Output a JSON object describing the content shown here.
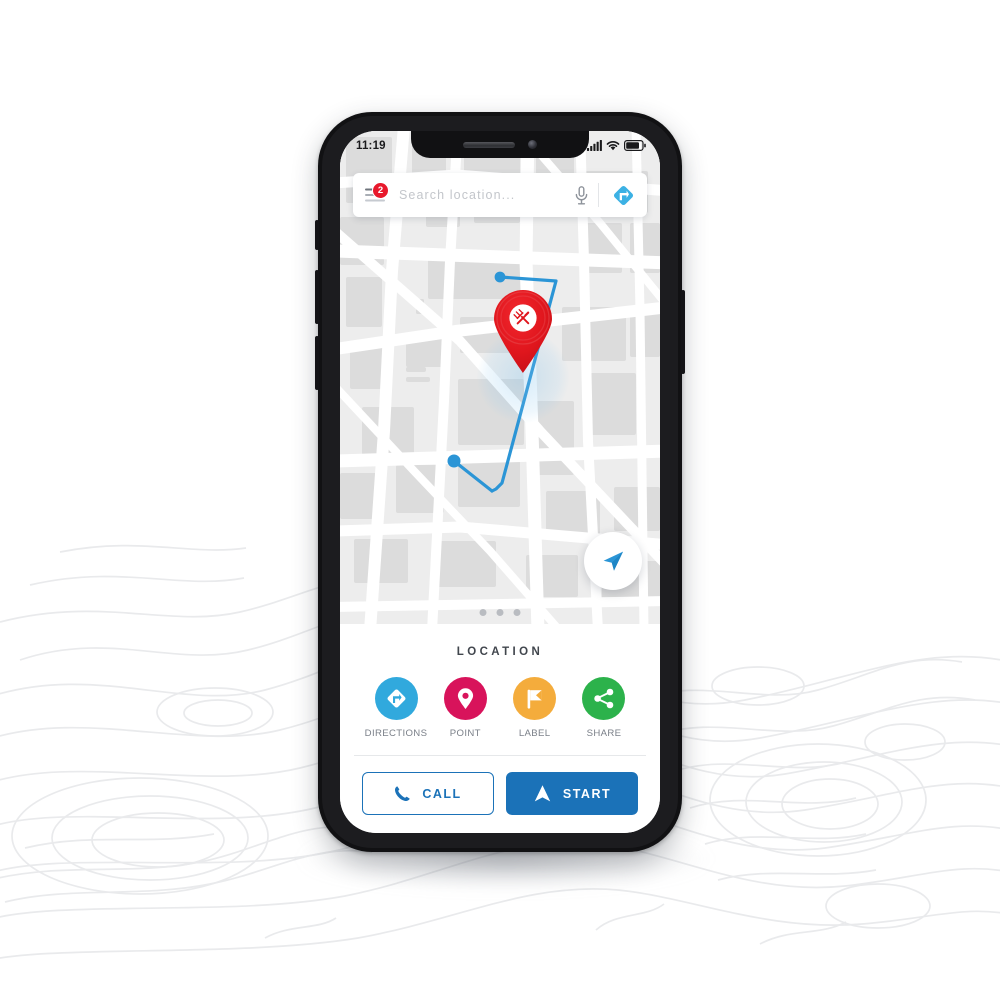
{
  "status_bar": {
    "time": "11:19",
    "icons": [
      "signal-bars-icon",
      "wifi-icon",
      "battery-icon"
    ]
  },
  "search": {
    "placeholder": "Search location...",
    "value": "",
    "menu_badge": "2",
    "menu_icon": "hamburger-menu-icon",
    "mic_icon": "microphone-icon",
    "directions_icon": "directions-diamond-icon"
  },
  "map": {
    "pin_icon": "restaurant-pin-icon",
    "fab_icon": "navigation-arrow-icon",
    "page_dots": 3,
    "route_color": "#2b95d6",
    "pin_color": "#e2171e"
  },
  "sheet": {
    "title": "LOCATION",
    "actions": [
      {
        "label": "DIRECTIONS",
        "icon": "directions-icon",
        "color": "#31a9dd"
      },
      {
        "label": "POINT",
        "icon": "map-pin-icon",
        "color": "#d8135b"
      },
      {
        "label": "LABEL",
        "icon": "flag-icon",
        "color": "#f4ac3c"
      },
      {
        "label": "SHARE",
        "icon": "share-icon",
        "color": "#2cb24b"
      }
    ],
    "cta": {
      "call_label": "CALL",
      "call_icon": "phone-icon",
      "start_label": "START",
      "start_icon": "navigation-arrow-icon"
    }
  },
  "theme": {
    "primary_blue": "#1b72b8",
    "map_bg": "#ededed",
    "road_color": "#ffffff",
    "block_color": "#dcdcdc"
  }
}
